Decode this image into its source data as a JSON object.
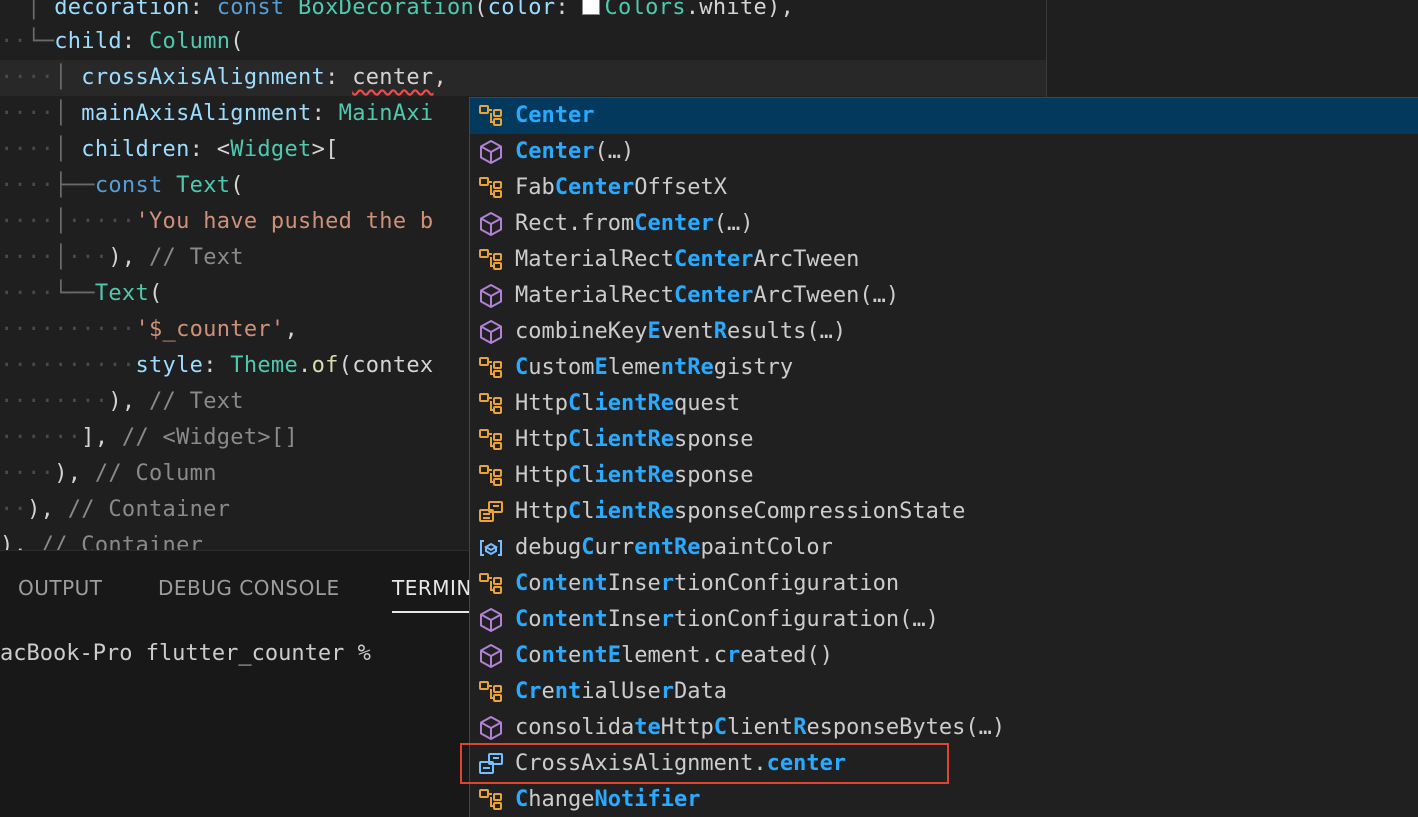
{
  "colors": {
    "editor_bg": "#1f1f1f",
    "keyword": "#569cd6",
    "class_name": "#4ec9b0",
    "property": "#9cdcfe",
    "string": "#ce9178",
    "comment": "#6a9955",
    "suggest_highlight": "#2aaaff",
    "suggest_selected_bg": "#04395e",
    "callout_border": "#e0432f",
    "class_icon": "#e8a33d",
    "method_icon": "#b180d7",
    "enum_icon": "#75beff"
  },
  "editor": {
    "line1": {
      "prop": "decoration",
      "colon": ": ",
      "kw": "const",
      "cls": "BoxDecoration",
      "open": "(",
      "arg": "color",
      "cls2": "Colors",
      "tail": ".white),",
      "swatch_color": "#ffffff"
    },
    "line2": {
      "prop": "child",
      "colon": ": ",
      "cls": "Column",
      "open": "("
    },
    "line3": {
      "prop": "crossAxisAlignment",
      "colon": ": ",
      "value": "center",
      "tail": ","
    },
    "line4": {
      "prop": "mainAxisAlignment",
      "colon": ": ",
      "value": "MainAxi"
    },
    "line5": {
      "prop": "children",
      "colon": ": ",
      "lt": "<",
      "cls": "Widget",
      "gt": ">["
    },
    "line6": {
      "kw": "const",
      "cls": "Text",
      "open": "("
    },
    "line7": {
      "str": "'You have pushed the b"
    },
    "line8": {
      "close": "),",
      "comment": "// Text"
    },
    "line9": {
      "cls": "Text",
      "open": "("
    },
    "line10": {
      "str": "'$_counter'",
      "tail": ","
    },
    "line11": {
      "prop": "style",
      "colon": ": ",
      "cls": "Theme",
      "dot": ".",
      "fn": "of",
      "tail": "(contex"
    },
    "line12": {
      "close": "),",
      "comment": "// Text"
    },
    "line13": {
      "close": "],",
      "comment": "// <Widget>[]"
    },
    "line14": {
      "close": "),",
      "comment": "// Column"
    },
    "line15": {
      "close": "),",
      "comment": "// Container"
    },
    "line16": {
      "close": "),",
      "comment": "// Container"
    }
  },
  "panel": {
    "tabs": [
      "OUTPUT",
      "DEBUG CONSOLE",
      "TERMINAL"
    ],
    "active_tab": "TERMINAL",
    "terminal_prompt": "acBook-Pro flutter_counter %"
  },
  "suggestions": [
    {
      "icon": "class-icon",
      "selected": true,
      "segments": [
        {
          "t": "Center",
          "h": true
        }
      ]
    },
    {
      "icon": "method-icon",
      "segments": [
        {
          "t": "Center",
          "h": true
        },
        {
          "t": "(…)",
          "h": false
        }
      ]
    },
    {
      "icon": "class-icon",
      "segments": [
        {
          "t": "Fab",
          "h": false
        },
        {
          "t": "Center",
          "h": true
        },
        {
          "t": "OffsetX",
          "h": false
        }
      ]
    },
    {
      "icon": "method-icon",
      "segments": [
        {
          "t": "Rect.from",
          "h": false
        },
        {
          "t": "Center",
          "h": true
        },
        {
          "t": "(…)",
          "h": false
        }
      ]
    },
    {
      "icon": "class-icon",
      "segments": [
        {
          "t": "MaterialRect",
          "h": false
        },
        {
          "t": "Center",
          "h": true
        },
        {
          "t": "ArcTween",
          "h": false
        }
      ]
    },
    {
      "icon": "method-icon",
      "segments": [
        {
          "t": "MaterialRect",
          "h": false
        },
        {
          "t": "Center",
          "h": true
        },
        {
          "t": "ArcTween(…)",
          "h": false
        }
      ]
    },
    {
      "icon": "method-icon",
      "segments": [
        {
          "t": "combine",
          "h": false
        },
        {
          "t": "K",
          "h": false
        },
        {
          "t": "ey",
          "h": false
        },
        {
          "t": "E",
          "h": true
        },
        {
          "t": "vent",
          "h": false
        },
        {
          "t": "R",
          "h": true
        },
        {
          "t": "esults(…)",
          "h": false
        }
      ]
    },
    {
      "icon": "class-icon",
      "segments": [
        {
          "t": "C",
          "h": true
        },
        {
          "t": "ustom",
          "h": false
        },
        {
          "t": "E",
          "h": true
        },
        {
          "t": "leme",
          "h": false
        },
        {
          "t": "ntRe",
          "h": true
        },
        {
          "t": "gistry",
          "h": false
        }
      ]
    },
    {
      "icon": "class-icon",
      "segments": [
        {
          "t": "Http",
          "h": false
        },
        {
          "t": "C",
          "h": true
        },
        {
          "t": "l",
          "h": false
        },
        {
          "t": "ientRe",
          "h": true
        },
        {
          "t": "quest",
          "h": false
        }
      ]
    },
    {
      "icon": "class-icon",
      "segments": [
        {
          "t": "Http",
          "h": false
        },
        {
          "t": "C",
          "h": true
        },
        {
          "t": "l",
          "h": false
        },
        {
          "t": "ientRe",
          "h": true
        },
        {
          "t": "sponse",
          "h": false
        }
      ]
    },
    {
      "icon": "class-icon",
      "segments": [
        {
          "t": "Http",
          "h": false
        },
        {
          "t": "C",
          "h": true
        },
        {
          "t": "l",
          "h": false
        },
        {
          "t": "ientRe",
          "h": true
        },
        {
          "t": "sponse",
          "h": false
        }
      ]
    },
    {
      "icon": "enum-icon",
      "segments": [
        {
          "t": "Http",
          "h": false
        },
        {
          "t": "C",
          "h": true
        },
        {
          "t": "l",
          "h": false
        },
        {
          "t": "ientRe",
          "h": true
        },
        {
          "t": "sponseCompressionState",
          "h": false
        }
      ]
    },
    {
      "icon": "variable-icon",
      "segments": [
        {
          "t": "debug",
          "h": false
        },
        {
          "t": "C",
          "h": true
        },
        {
          "t": "urr",
          "h": false
        },
        {
          "t": "entRe",
          "h": true
        },
        {
          "t": "paintColor",
          "h": false
        }
      ]
    },
    {
      "icon": "class-icon",
      "segments": [
        {
          "t": "C",
          "h": true
        },
        {
          "t": "o",
          "h": false
        },
        {
          "t": "nt",
          "h": true
        },
        {
          "t": "e",
          "h": false
        },
        {
          "t": "nt",
          "h": true
        },
        {
          "t": "Inse",
          "h": false
        },
        {
          "t": "r",
          "h": true
        },
        {
          "t": "tionConfiguration",
          "h": false
        }
      ]
    },
    {
      "icon": "method-icon",
      "segments": [
        {
          "t": "C",
          "h": true
        },
        {
          "t": "o",
          "h": false
        },
        {
          "t": "nt",
          "h": true
        },
        {
          "t": "e",
          "h": false
        },
        {
          "t": "nt",
          "h": true
        },
        {
          "t": "Inse",
          "h": false
        },
        {
          "t": "r",
          "h": true
        },
        {
          "t": "tionConfiguration(…)",
          "h": false
        }
      ]
    },
    {
      "icon": "method-icon",
      "segments": [
        {
          "t": "C",
          "h": true
        },
        {
          "t": "o",
          "h": false
        },
        {
          "t": "nt",
          "h": true
        },
        {
          "t": "e",
          "h": false
        },
        {
          "t": "nt",
          "h": true
        },
        {
          "t": "E",
          "h": true
        },
        {
          "t": "lement.c",
          "h": false
        },
        {
          "t": "r",
          "h": true
        },
        {
          "t": "eated()",
          "h": false
        }
      ]
    },
    {
      "icon": "class-icon",
      "segments": [
        {
          "t": "C",
          "h": true
        },
        {
          "t": "r",
          "h": true
        },
        {
          "t": "e",
          "h": false
        },
        {
          "t": "nt",
          "h": true
        },
        {
          "t": "ialUse",
          "h": false
        },
        {
          "t": "r",
          "h": true
        },
        {
          "t": "Data",
          "h": false
        }
      ]
    },
    {
      "icon": "method-icon",
      "segments": [
        {
          "t": "consolida",
          "h": false
        },
        {
          "t": "te",
          "h": true
        },
        {
          "t": "Http",
          "h": false
        },
        {
          "t": "C",
          "h": true
        },
        {
          "t": "lient",
          "h": false
        },
        {
          "t": "R",
          "h": true
        },
        {
          "t": "esponseBytes(…)",
          "h": false
        }
      ]
    },
    {
      "icon": "enum-member-icon",
      "segments": [
        {
          "t": "CrossAxisAlignment.",
          "h": false
        },
        {
          "t": "center",
          "h": true
        }
      ]
    },
    {
      "icon": "class-icon",
      "segments": [
        {
          "t": "C",
          "h": true
        },
        {
          "t": "hange",
          "h": false
        },
        {
          "t": "N",
          "h": true
        },
        {
          "t": "otifier",
          "h": true
        }
      ]
    }
  ]
}
